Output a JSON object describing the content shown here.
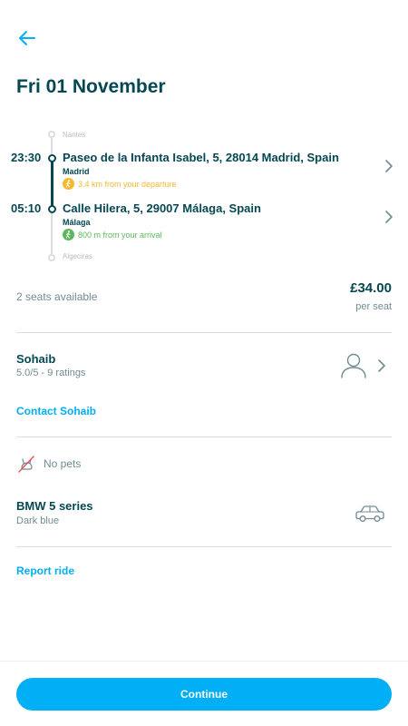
{
  "header": {
    "back_icon": "arrow-left-icon",
    "title": "Fri 01 November"
  },
  "itinerary": {
    "origin_city_faded": "Nantes",
    "destination_city_faded": "Algeciras",
    "stops": [
      {
        "time": "23:30",
        "address": "Paseo de la Infanta Isabel, 5, 28014 Madrid, Spain",
        "city": "Madrid",
        "distance": "3.4 km from your departure",
        "distance_color": "#f5b82e"
      },
      {
        "time": "05:10",
        "address": "Calle Hilera, 5, 29007 Málaga, Spain",
        "city": "Málaga",
        "distance": "800 m from your arrival",
        "distance_color": "#5cb85c"
      }
    ]
  },
  "booking": {
    "seats": "2 seats available",
    "price": "£34.00",
    "per_seat": "per seat"
  },
  "driver": {
    "name": "Sohaib",
    "rating": "5.0/5 - 9 ratings",
    "contact": "Contact Sohaib"
  },
  "preferences": {
    "pets": "No pets"
  },
  "car": {
    "model": "BMW 5 series",
    "color": "Dark blue"
  },
  "actions": {
    "report": "Report ride",
    "continue": "Continue"
  },
  "colors": {
    "primary": "#00aff5",
    "text_dark": "#054752",
    "text_muted": "#708c91"
  }
}
